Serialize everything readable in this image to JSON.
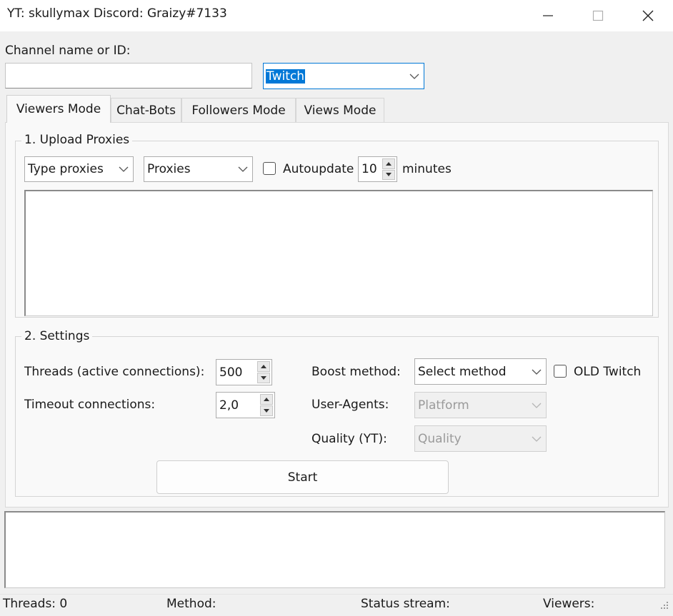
{
  "window": {
    "title": "YT: skullymax Discord: Graizy#7133",
    "colors": {
      "titlebar": "#ffffff",
      "client": "#f0f0f0",
      "selection": "#0078d7"
    }
  },
  "channel": {
    "label": "Channel name or ID:",
    "value": "",
    "platform": "Twitch"
  },
  "tabs": [
    {
      "label": "Viewers Mode",
      "active": true
    },
    {
      "label": "Chat-Bots",
      "active": false
    },
    {
      "label": "Followers Mode",
      "active": false
    },
    {
      "label": "Views Mode",
      "active": false
    }
  ],
  "proxies": {
    "title": "1. Upload Proxies",
    "type_select": "Type proxies",
    "source_select": "Proxies",
    "autoupdate_label": "Autoupdate",
    "autoupdate_checked": false,
    "interval": "10",
    "minutes_label": "minutes",
    "list_text": ""
  },
  "settings": {
    "title": "2. Settings",
    "threads_label": "Threads (active connections):",
    "threads_value": "500",
    "timeout_label": "Timeout connections:",
    "timeout_value": "2,0",
    "boost_label": "Boost method:",
    "boost_value": "Select method",
    "old_twitch_label": "OLD Twitch",
    "old_twitch_checked": false,
    "ua_label": "User-Agents:",
    "ua_value": "Platform",
    "quality_label": "Quality (YT):",
    "quality_value": "Quality",
    "start_label": "Start"
  },
  "log": {
    "text": ""
  },
  "status": {
    "threads": "Threads: 0",
    "method": "Method:",
    "stream": "Status stream:",
    "viewers": "Viewers:"
  },
  "icons": {
    "minimize": "minimize-icon",
    "maximize": "maximize-icon",
    "close": "close-icon",
    "dropdown": "chevron-down-icon",
    "spin_up": "arrow-up-icon",
    "spin_down": "arrow-down-icon",
    "grip": "resize-grip-icon"
  }
}
